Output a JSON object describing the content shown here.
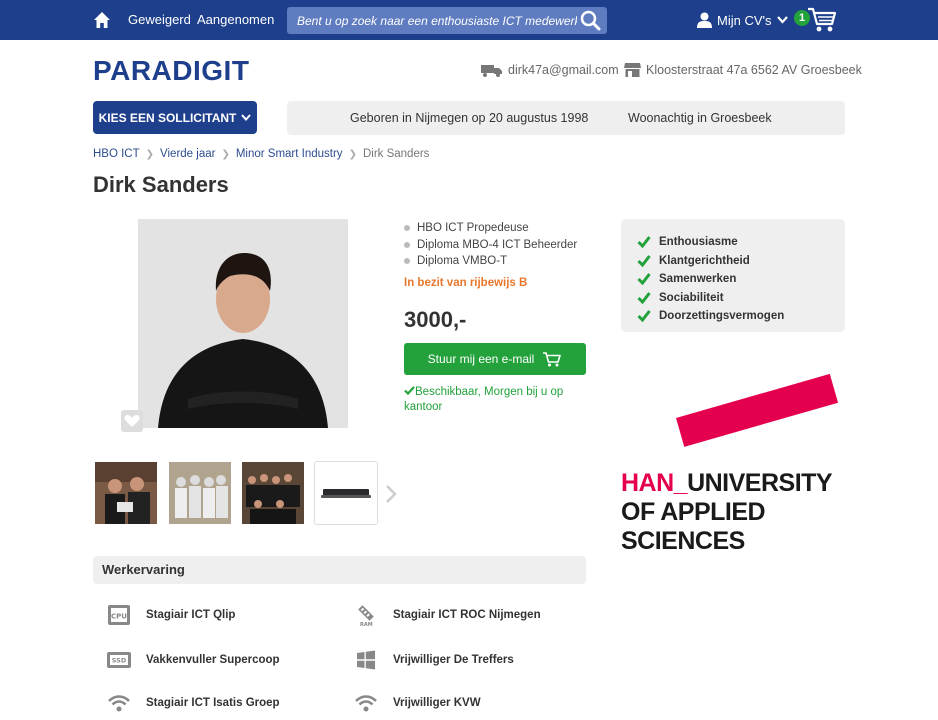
{
  "topbar": {
    "home_icon": "home-icon",
    "links": [
      "Geweigerd",
      "Aangenomen"
    ],
    "search_placeholder": "Bent u op zoek naar een enthousiaste ICT medewerker?",
    "mycv_label": "Mijn CV's",
    "cart_count": "1"
  },
  "brand": {
    "logo": "PARADIGIT",
    "email": "dirk47a@gmail.com",
    "address": "Kloosterstraat 47a 6562 AV Groesbeek"
  },
  "kies_button": "KIES EEN SOLLICITANT",
  "infobar": {
    "born": "Geboren in Nijmegen op 20 augustus 1998",
    "lives": "Woonachtig in Groesbeek"
  },
  "breadcrumb": [
    "HBO ICT",
    "Vierde jaar",
    "Minor Smart Industry",
    "Dirk Sanders"
  ],
  "candidate": {
    "name": "Dirk Sanders",
    "qualifications": [
      "HBO ICT Propedeuse",
      "Diploma MBO-4 ICT Beheerder",
      "Diploma VMBO-T"
    ],
    "license": "In bezit van rijbewijs B",
    "price": "3000,-",
    "mail_button": "Stuur mij een e-mail",
    "availability": "Beschikbaar, Morgen bij u op kantoor"
  },
  "traits": [
    "Enthousiasme",
    "Klantgerichtheid",
    "Samenwerken",
    "Sociabiliteit",
    "Doorzettingsvermogen"
  ],
  "han_logo": {
    "line1_red": "HAN_",
    "line1_rest": "UNIVERSITY",
    "line2": "OF APPLIED SCIENCES"
  },
  "werkervaring": {
    "title": "Werkervaring",
    "jobs": [
      {
        "label": "Stagiair ICT Qlip",
        "icon": "cpu-icon"
      },
      {
        "label": "Stagiair ICT ROC Nijmegen",
        "icon": "ram-icon"
      },
      {
        "label": "Vakkenvuller Supercoop",
        "icon": "ssd-icon"
      },
      {
        "label": "Vrijwilliger De Treffers",
        "icon": "windows-icon"
      },
      {
        "label": "Stagiair ICT Isatis Groep",
        "icon": "wifi-icon"
      },
      {
        "label": "Vrijwilliger KVW",
        "icon": "wifi-icon"
      }
    ]
  },
  "colors": {
    "brand_blue": "#1e3f8c",
    "green": "#23a23b",
    "orange": "#e8772e",
    "han_red": "#e5004f"
  }
}
